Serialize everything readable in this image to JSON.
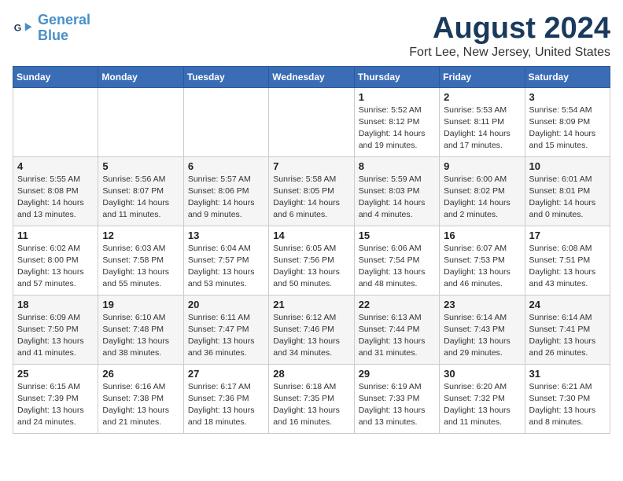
{
  "logo": {
    "line1": "General",
    "line2": "Blue"
  },
  "title": {
    "month": "August 2024",
    "location": "Fort Lee, New Jersey, United States"
  },
  "weekdays": [
    "Sunday",
    "Monday",
    "Tuesday",
    "Wednesday",
    "Thursday",
    "Friday",
    "Saturday"
  ],
  "weeks": [
    [
      {
        "day": "",
        "info": ""
      },
      {
        "day": "",
        "info": ""
      },
      {
        "day": "",
        "info": ""
      },
      {
        "day": "",
        "info": ""
      },
      {
        "day": "1",
        "info": "Sunrise: 5:52 AM\nSunset: 8:12 PM\nDaylight: 14 hours\nand 19 minutes."
      },
      {
        "day": "2",
        "info": "Sunrise: 5:53 AM\nSunset: 8:11 PM\nDaylight: 14 hours\nand 17 minutes."
      },
      {
        "day": "3",
        "info": "Sunrise: 5:54 AM\nSunset: 8:09 PM\nDaylight: 14 hours\nand 15 minutes."
      }
    ],
    [
      {
        "day": "4",
        "info": "Sunrise: 5:55 AM\nSunset: 8:08 PM\nDaylight: 14 hours\nand 13 minutes."
      },
      {
        "day": "5",
        "info": "Sunrise: 5:56 AM\nSunset: 8:07 PM\nDaylight: 14 hours\nand 11 minutes."
      },
      {
        "day": "6",
        "info": "Sunrise: 5:57 AM\nSunset: 8:06 PM\nDaylight: 14 hours\nand 9 minutes."
      },
      {
        "day": "7",
        "info": "Sunrise: 5:58 AM\nSunset: 8:05 PM\nDaylight: 14 hours\nand 6 minutes."
      },
      {
        "day": "8",
        "info": "Sunrise: 5:59 AM\nSunset: 8:03 PM\nDaylight: 14 hours\nand 4 minutes."
      },
      {
        "day": "9",
        "info": "Sunrise: 6:00 AM\nSunset: 8:02 PM\nDaylight: 14 hours\nand 2 minutes."
      },
      {
        "day": "10",
        "info": "Sunrise: 6:01 AM\nSunset: 8:01 PM\nDaylight: 14 hours\nand 0 minutes."
      }
    ],
    [
      {
        "day": "11",
        "info": "Sunrise: 6:02 AM\nSunset: 8:00 PM\nDaylight: 13 hours\nand 57 minutes."
      },
      {
        "day": "12",
        "info": "Sunrise: 6:03 AM\nSunset: 7:58 PM\nDaylight: 13 hours\nand 55 minutes."
      },
      {
        "day": "13",
        "info": "Sunrise: 6:04 AM\nSunset: 7:57 PM\nDaylight: 13 hours\nand 53 minutes."
      },
      {
        "day": "14",
        "info": "Sunrise: 6:05 AM\nSunset: 7:56 PM\nDaylight: 13 hours\nand 50 minutes."
      },
      {
        "day": "15",
        "info": "Sunrise: 6:06 AM\nSunset: 7:54 PM\nDaylight: 13 hours\nand 48 minutes."
      },
      {
        "day": "16",
        "info": "Sunrise: 6:07 AM\nSunset: 7:53 PM\nDaylight: 13 hours\nand 46 minutes."
      },
      {
        "day": "17",
        "info": "Sunrise: 6:08 AM\nSunset: 7:51 PM\nDaylight: 13 hours\nand 43 minutes."
      }
    ],
    [
      {
        "day": "18",
        "info": "Sunrise: 6:09 AM\nSunset: 7:50 PM\nDaylight: 13 hours\nand 41 minutes."
      },
      {
        "day": "19",
        "info": "Sunrise: 6:10 AM\nSunset: 7:48 PM\nDaylight: 13 hours\nand 38 minutes."
      },
      {
        "day": "20",
        "info": "Sunrise: 6:11 AM\nSunset: 7:47 PM\nDaylight: 13 hours\nand 36 minutes."
      },
      {
        "day": "21",
        "info": "Sunrise: 6:12 AM\nSunset: 7:46 PM\nDaylight: 13 hours\nand 34 minutes."
      },
      {
        "day": "22",
        "info": "Sunrise: 6:13 AM\nSunset: 7:44 PM\nDaylight: 13 hours\nand 31 minutes."
      },
      {
        "day": "23",
        "info": "Sunrise: 6:14 AM\nSunset: 7:43 PM\nDaylight: 13 hours\nand 29 minutes."
      },
      {
        "day": "24",
        "info": "Sunrise: 6:14 AM\nSunset: 7:41 PM\nDaylight: 13 hours\nand 26 minutes."
      }
    ],
    [
      {
        "day": "25",
        "info": "Sunrise: 6:15 AM\nSunset: 7:39 PM\nDaylight: 13 hours\nand 24 minutes."
      },
      {
        "day": "26",
        "info": "Sunrise: 6:16 AM\nSunset: 7:38 PM\nDaylight: 13 hours\nand 21 minutes."
      },
      {
        "day": "27",
        "info": "Sunrise: 6:17 AM\nSunset: 7:36 PM\nDaylight: 13 hours\nand 18 minutes."
      },
      {
        "day": "28",
        "info": "Sunrise: 6:18 AM\nSunset: 7:35 PM\nDaylight: 13 hours\nand 16 minutes."
      },
      {
        "day": "29",
        "info": "Sunrise: 6:19 AM\nSunset: 7:33 PM\nDaylight: 13 hours\nand 13 minutes."
      },
      {
        "day": "30",
        "info": "Sunrise: 6:20 AM\nSunset: 7:32 PM\nDaylight: 13 hours\nand 11 minutes."
      },
      {
        "day": "31",
        "info": "Sunrise: 6:21 AM\nSunset: 7:30 PM\nDaylight: 13 hours\nand 8 minutes."
      }
    ]
  ]
}
